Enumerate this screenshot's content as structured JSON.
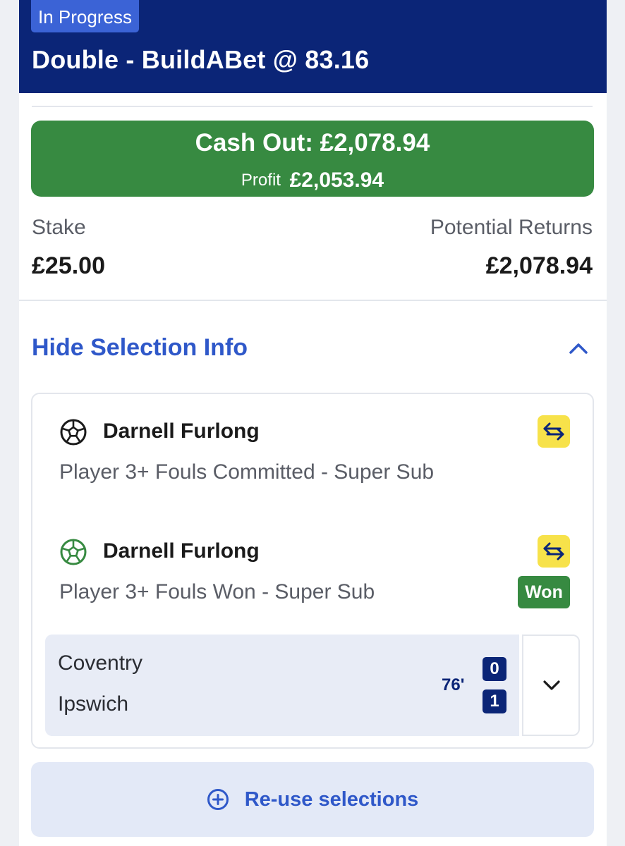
{
  "header": {
    "status": "In Progress",
    "title": "Double - BuildABet @ 83.16"
  },
  "cash_out": {
    "label": "Cash Out: £2,078.94",
    "profit_label": "Profit",
    "profit_value": "£2,053.94"
  },
  "stake": {
    "label": "Stake",
    "value": "£25.00"
  },
  "returns": {
    "label": "Potential Returns",
    "value": "£2,078.94"
  },
  "toggle": {
    "label": "Hide Selection Info"
  },
  "selections": [
    {
      "player": "Darnell Furlong",
      "market": "Player 3+ Fouls Committed - Super Sub",
      "icon": "football-icon",
      "icon_color": "#1a1a1a",
      "result": ""
    },
    {
      "player": "Darnell Furlong",
      "market": "Player 3+ Fouls Won - Super Sub",
      "icon": "football-icon",
      "icon_color": "#378a41",
      "result": "Won"
    }
  ],
  "match": {
    "home_team": "Coventry",
    "away_team": "Ipswich",
    "clock": "76'",
    "home_score": "0",
    "away_score": "1"
  },
  "reuse": {
    "label": "Re-use selections"
  },
  "colors": {
    "header_bg": "#0b2577",
    "status_pill": "#3b63d6",
    "cash_out_green": "#378a41",
    "link_blue": "#2f58c9",
    "swap_badge_yellow": "#f7e24a"
  }
}
